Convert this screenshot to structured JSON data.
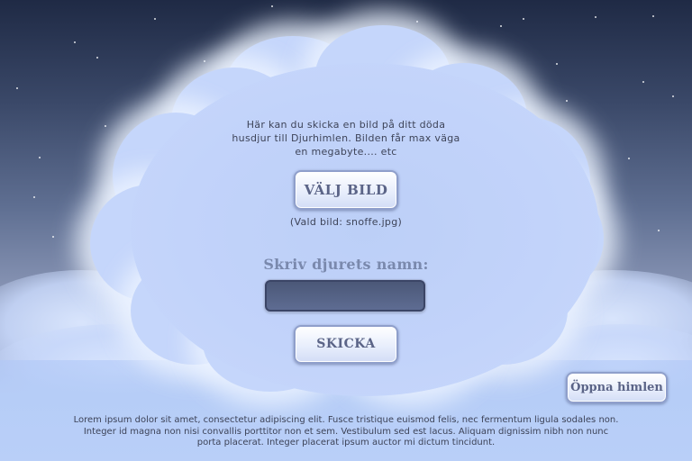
{
  "intro_text": "Här kan du skicka en bild på ditt döda husdjur till Djurhimlen. Bilden får max väga en megabyte.... etc",
  "choose_button_label": "VÄLJ BILD",
  "selected_file_text": "(Vald bild: snoffe.jpg)",
  "name_label": "Skriv djurets namn:",
  "name_input": {
    "value": "",
    "placeholder": ""
  },
  "send_button_label": "SKICKA",
  "open_heaven_button_label": "Öppna himlen",
  "footer_text": "Lorem ipsum dolor sit amet, consectetur adipiscing elit. Fusce tristique euismod felis, nec fermentum ligula sodales non. Integer id magna non nisi convallis porttitor non et sem. Vestibulum sed est lacus. Aliquam dignissim nibh non nunc porta placerat. Integer placerat ipsum auctor mi dictum tincidunt.",
  "colors": {
    "sky_top": "#1f2a45",
    "cloud": "#c5d6fb",
    "input_bg": "#4b5878",
    "button_text": "#5b6487"
  }
}
